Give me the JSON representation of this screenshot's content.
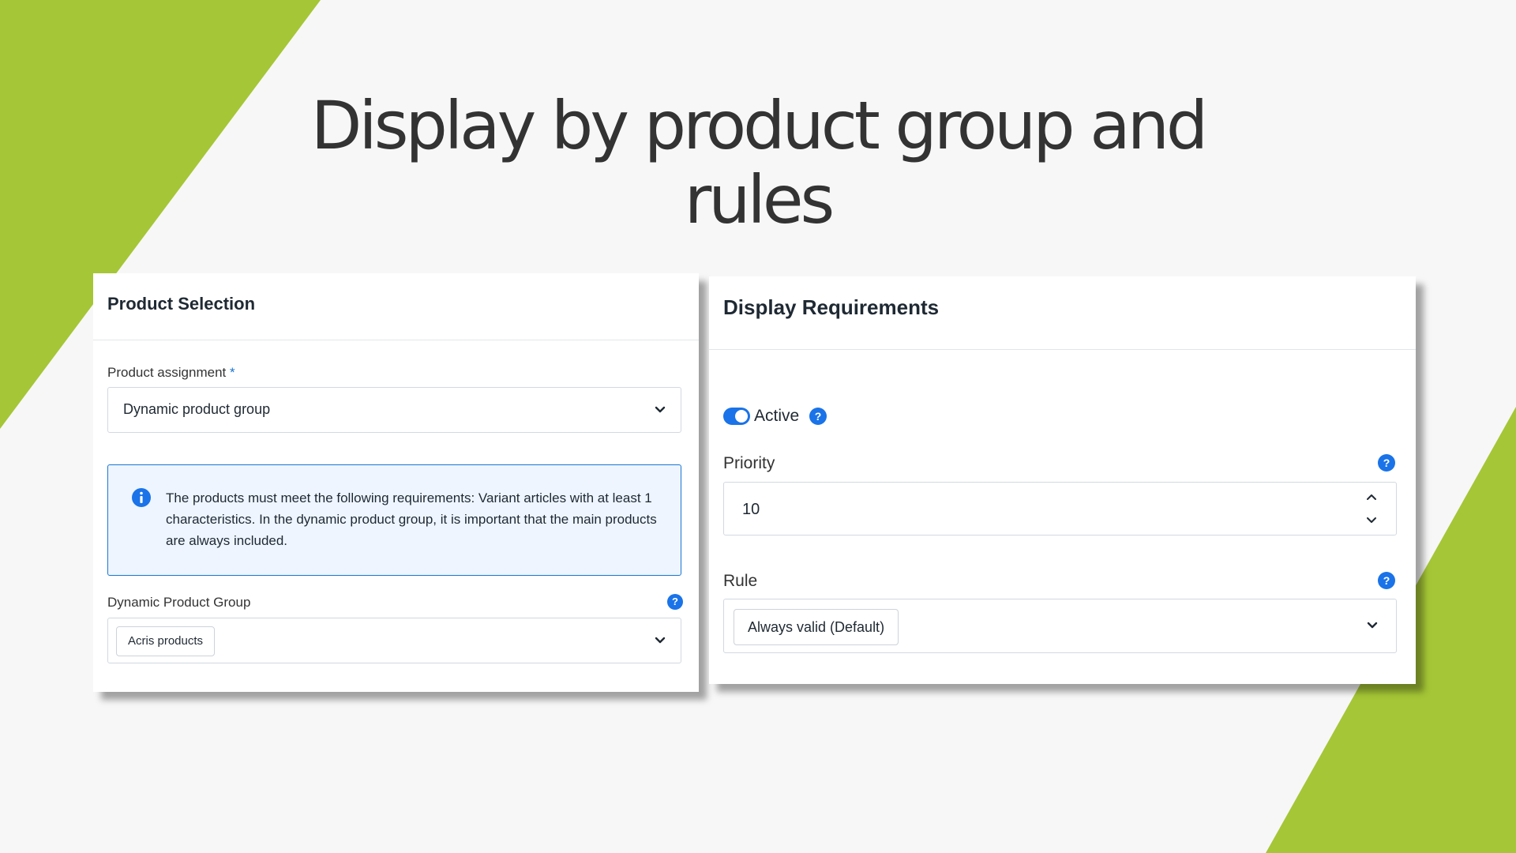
{
  "slide": {
    "title_line1": "Display by product group and",
    "title_line2": "rules",
    "colors": {
      "accent": "#a5c636",
      "background": "#f7f7f7",
      "primary": "#1a73e8"
    }
  },
  "product_selection": {
    "title": "Product Selection",
    "assignment_label": "Product assignment",
    "required_marker": "*",
    "assignment_value": "Dynamic product group",
    "notice_icon": "info-icon",
    "notice_text": "The products must meet the following requirements: Variant articles with at least 1 characteristics. In the dynamic product group, it is important that the main products are always included.",
    "group_label": "Dynamic Product Group",
    "group_value": "Acris products",
    "help_glyph": "?"
  },
  "display_requirements": {
    "title": "Display Requirements",
    "active_label": "Active",
    "active_on": true,
    "priority_label": "Priority",
    "priority_value": "10",
    "rule_label": "Rule",
    "rule_value": "Always valid (Default)",
    "help_glyph": "?"
  }
}
